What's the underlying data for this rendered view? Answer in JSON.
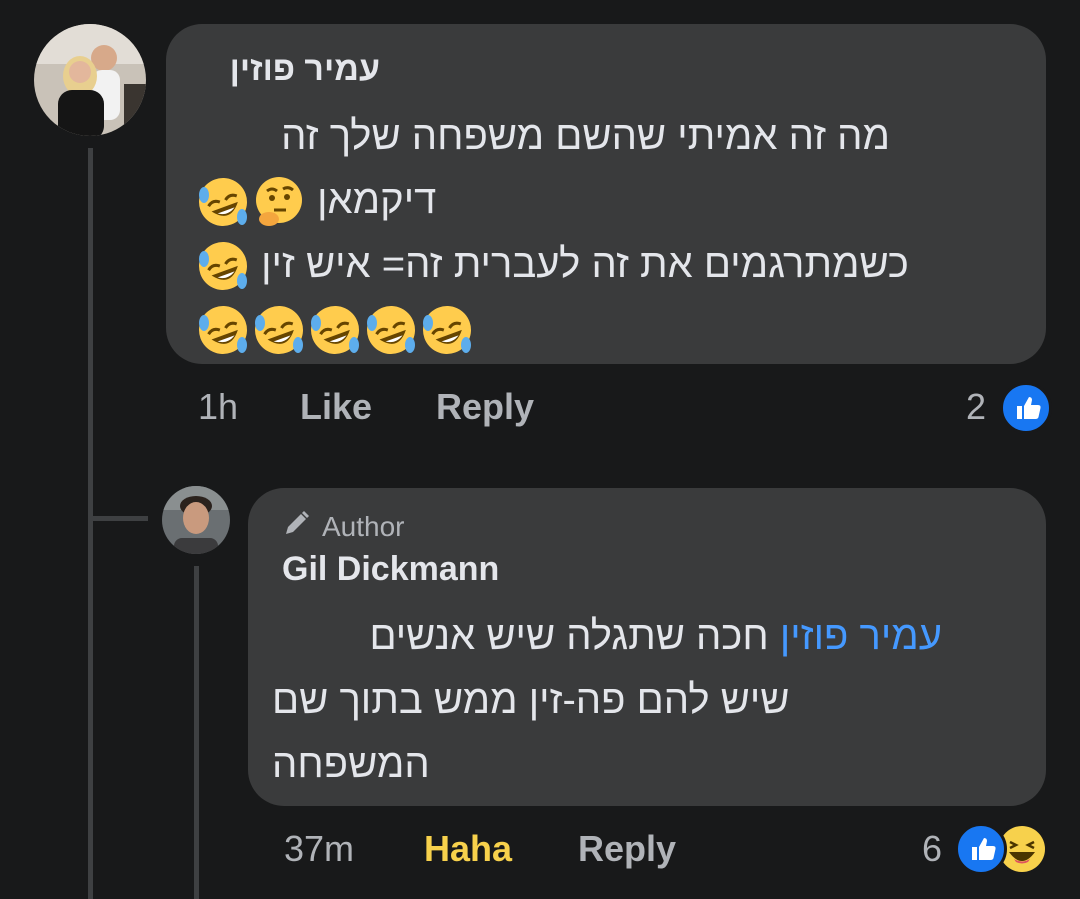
{
  "comment1": {
    "author": "עמיר פוזין",
    "lines": [
      "מה זה אמיתי שהשם משפחה שלך זה",
      "דיקמאן",
      "כשמתרגמים את זה לעברית זה= איש זין"
    ],
    "time": "1h",
    "like_label": "Like",
    "reply_label": "Reply",
    "reaction_count": "2",
    "reactions": [
      "like-icon"
    ],
    "emojis": {
      "line2": [
        "thinking-emoji",
        "rofl-emoji"
      ],
      "line3": [
        "rofl-emoji"
      ],
      "line4": [
        "rofl-emoji",
        "rofl-emoji",
        "rofl-emoji",
        "rofl-emoji",
        "rofl-emoji"
      ]
    }
  },
  "reply1": {
    "badge": "Author",
    "author": "Gil Dickmann",
    "mention": "עמיר פוזין",
    "line1_rest": "חכה שתגלה שיש אנשים",
    "line2": "שיש להם פה-זין ממש בתוך שם",
    "line3": "המשפחה",
    "time": "37m",
    "like_label": "Haha",
    "reply_label": "Reply",
    "reaction_count": "6",
    "reactions": [
      "like-icon",
      "haha-icon"
    ]
  },
  "colors": {
    "background": "#18191a",
    "bubble": "#3a3b3c",
    "mention": "#4599ff",
    "haha": "#f7d14c",
    "like_blue": "#1877f2"
  }
}
